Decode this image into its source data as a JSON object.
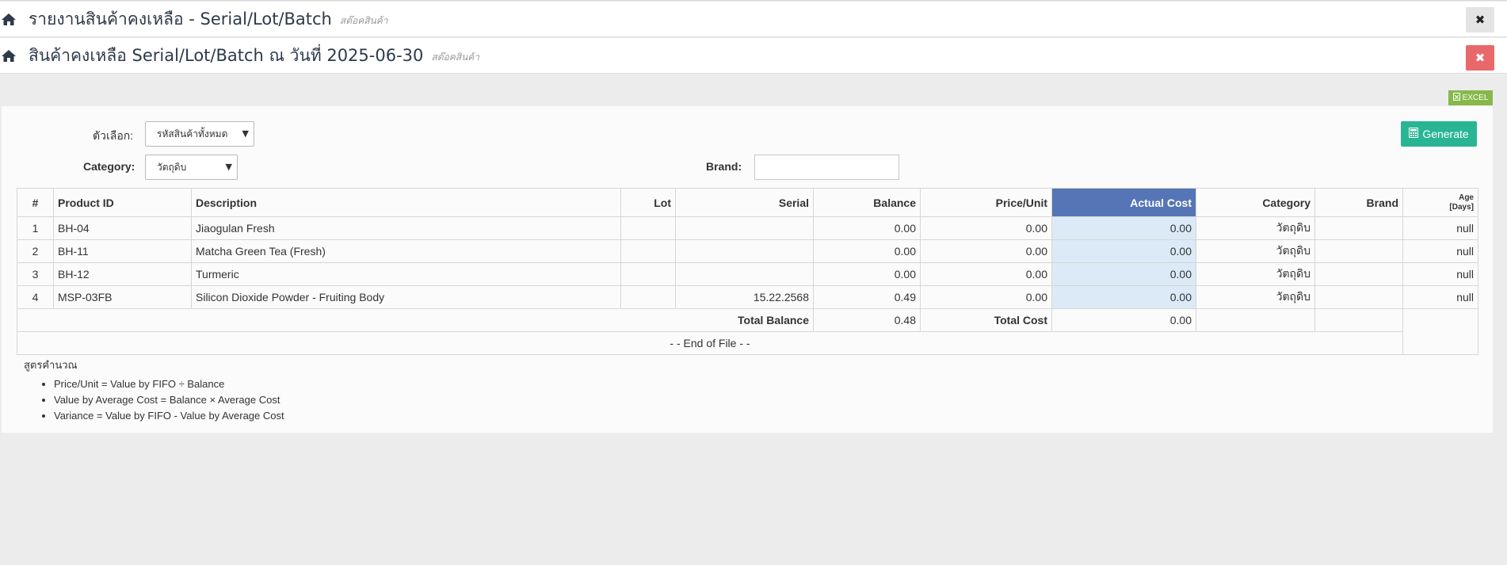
{
  "window1": {
    "title": "รายงานสินค้าคงเหลือ - Serial/Lot/Batch",
    "subtitle": "สต๊อคสินค้า",
    "close_icon": "close-icon"
  },
  "window2": {
    "title": "สินค้าคงเหลือ Serial/Lot/Batch ณ วันที่ 2025-06-30",
    "subtitle": "สต๊อคสินค้า",
    "close_icon": "close-icon"
  },
  "toolbar": {
    "excel_label": "EXCEL",
    "generate_label": "Generate"
  },
  "filters": {
    "option_label": "ตัวเลือก:",
    "option_value": "รหัสสินค้าทั้งหมด",
    "category_label": "Category:",
    "category_value": "วัตถุดิบ",
    "brand_label": "Brand:",
    "brand_value": ""
  },
  "table": {
    "headers": {
      "num": "#",
      "product_id": "Product ID",
      "description": "Description",
      "lot": "Lot",
      "serial": "Serial",
      "balance": "Balance",
      "price_unit": "Price/Unit",
      "actual_cost": "Actual Cost",
      "category": "Category",
      "brand": "Brand",
      "age_line1": "Age",
      "age_line2": "[Days]"
    },
    "rows": [
      {
        "num": "1",
        "product_id": "BH-04",
        "description": "Jiaogulan Fresh",
        "lot": "",
        "serial": "",
        "balance": "0.00",
        "price_unit": "0.00",
        "actual_cost": "0.00",
        "category": "วัตถุดิบ",
        "brand": "",
        "age": "null"
      },
      {
        "num": "2",
        "product_id": "BH-11",
        "description": "Matcha Green Tea (Fresh)",
        "lot": "",
        "serial": "",
        "balance": "0.00",
        "price_unit": "0.00",
        "actual_cost": "0.00",
        "category": "วัตถุดิบ",
        "brand": "",
        "age": "null"
      },
      {
        "num": "3",
        "product_id": "BH-12",
        "description": "Turmeric",
        "lot": "",
        "serial": "",
        "balance": "0.00",
        "price_unit": "0.00",
        "actual_cost": "0.00",
        "category": "วัตถุดิบ",
        "brand": "",
        "age": "null"
      },
      {
        "num": "4",
        "product_id": "MSP-03FB",
        "description": "Silicon Dioxide Powder - Fruiting Body",
        "lot": "",
        "serial": "15.22.2568",
        "balance": "0.49",
        "price_unit": "0.00",
        "actual_cost": "0.00",
        "category": "วัตถุดิบ",
        "brand": "",
        "age": "null"
      }
    ],
    "totals": {
      "balance_label": "Total Balance",
      "balance_value": "0.48",
      "cost_label": "Total Cost",
      "cost_value": "0.00"
    },
    "end_of_file": "- - End of File - -"
  },
  "formula": {
    "title": "สูตรคำนวณ",
    "items": [
      "Price/Unit = Value by FIFO ÷ Balance",
      "Value by Average Cost = Balance × Average Cost",
      "Variance = Value by FIFO - Value by Average Cost"
    ]
  },
  "colors": {
    "generate": "#29b594",
    "excel": "#87b84a",
    "actual_cost_header": "#5575b6",
    "close2": "#e9686a"
  }
}
